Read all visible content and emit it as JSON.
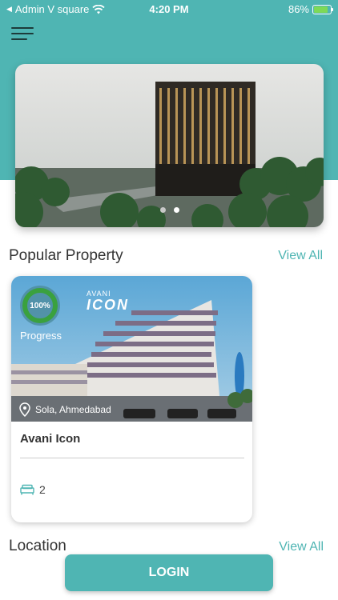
{
  "status_bar": {
    "carrier": "Admin V square",
    "time": "4:20 PM",
    "battery": "86%"
  },
  "banner": {
    "slides": 2,
    "active_slide": 2
  },
  "popular": {
    "title": "Popular Property",
    "view_all": "View All",
    "property": {
      "progress": "100%",
      "progress_label": "Progress",
      "location": "Sola, Ahmedabad",
      "name": "Avani Icon",
      "bedrooms": "2",
      "brand_line1": "AVANI",
      "brand_line2": "ICON"
    }
  },
  "next_section": {
    "title": "Location",
    "view_all": "View All"
  },
  "login": {
    "label": "LOGIN"
  },
  "colors": {
    "accent": "#4fb5b3",
    "progress": "#3aa13e"
  },
  "icons": {
    "menu": "hamburger-icon",
    "wifi": "wifi-icon",
    "battery": "battery-icon",
    "location": "location-pin-icon",
    "bed": "bed-icon"
  }
}
